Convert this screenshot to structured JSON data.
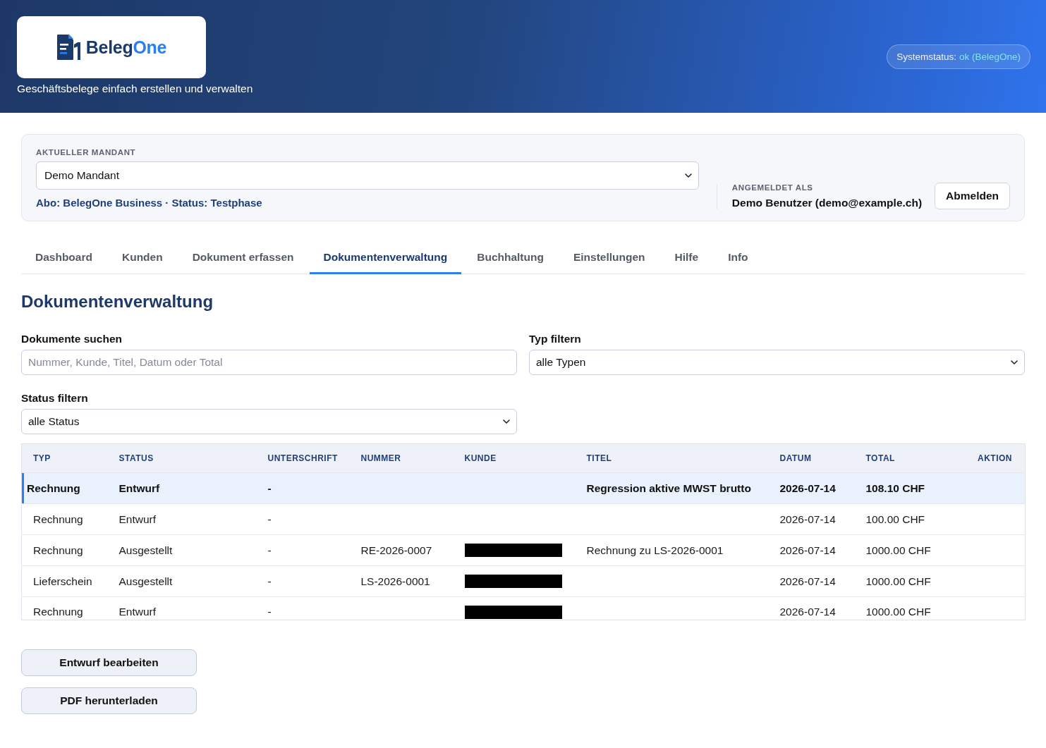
{
  "header": {
    "logo": {
      "parts": [
        {
          "text": "Beleg",
          "color": "#1b3a6b"
        },
        {
          "text": "One",
          "color": "#2b7ff0"
        }
      ]
    },
    "tagline": "Geschäftsbelege einfach erstellen und verwalten",
    "system_status": {
      "label": "Systemstatus:",
      "value": "ok (BelegOne)",
      "healthy": true
    }
  },
  "tenant_panel": {
    "label": "AKTUELLER MANDANT",
    "tenant_select": {
      "value": "Demo Mandant"
    },
    "subscription": "Abo: BelegOne Business · Status: Testphase",
    "user_label": "ANGEMELDET ALS",
    "user": "Demo Benutzer (demo@example.ch)",
    "logout_button": "Abmelden"
  },
  "tabs": [
    {
      "label": "Dashboard",
      "selected": false
    },
    {
      "label": "Kunden",
      "selected": false
    },
    {
      "label": "Dokument erfassen",
      "selected": false
    },
    {
      "label": "Dokumentenverwaltung",
      "selected": true
    },
    {
      "label": "Buchhaltung",
      "selected": false
    },
    {
      "label": "Einstellungen",
      "selected": false
    },
    {
      "label": "Hilfe",
      "selected": false
    },
    {
      "label": "Info",
      "selected": false
    }
  ],
  "page_title": "Dokumentenverwaltung",
  "filters": [
    {
      "kind": "search",
      "label": "Dokumente suchen",
      "placeholder": "Nummer, Kunde, Titel, Datum oder Total"
    },
    {
      "kind": "select",
      "label": "Typ filtern",
      "value": "alle Typen"
    },
    {
      "kind": "select",
      "label": "Status filtern",
      "value": "alle Status"
    }
  ],
  "table": {
    "columns": [
      "TYP",
      "STATUS",
      "UNTERSCHRIFT",
      "NUMMER",
      "KUNDE",
      "TITEL",
      "DATUM",
      "TOTAL",
      "AKTION"
    ],
    "rows": [
      {
        "selected": true,
        "typ": "Rechnung",
        "status": "Entwurf",
        "unterschrift": "-",
        "kunde_redacted": false,
        "titel": "Regression aktive MWST brutto",
        "datum": "2026-07-14",
        "total": "108.10 CHF"
      },
      {
        "selected": false,
        "typ": "Rechnung",
        "status": "Entwurf",
        "unterschrift": "-",
        "kunde_redacted": false,
        "datum": "2026-07-14",
        "total": "100.00 CHF"
      },
      {
        "selected": false,
        "typ": "Rechnung",
        "status": "Ausgestellt",
        "unterschrift": "-",
        "nummer": "RE-2026-0007",
        "kunde_redacted": true,
        "titel": "Rechnung zu LS-2026-0001",
        "datum": "2026-07-14",
        "total": "1000.00 CHF"
      },
      {
        "selected": false,
        "typ": "Lieferschein",
        "status": "Ausgestellt",
        "unterschrift": "-",
        "nummer": "LS-2026-0001",
        "kunde_redacted": true,
        "datum": "2026-07-14",
        "total": "1000.00 CHF"
      },
      {
        "selected": false,
        "typ": "Rechnung",
        "status": "Entwurf",
        "unterschrift": "-",
        "kunde_redacted": true,
        "datum": "2026-07-14",
        "total": "1000.00 CHF"
      }
    ]
  },
  "actions": [
    "Entwurf bearbeiten",
    "PDF herunterladen"
  ]
}
